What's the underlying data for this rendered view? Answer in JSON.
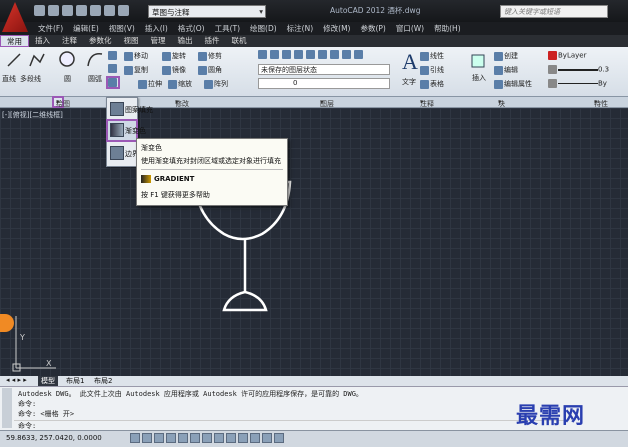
{
  "window": {
    "workspace": "草图与注释",
    "title": "AutoCAD 2012  酒杯.dwg",
    "search_placeholder": "键入关键字或短语"
  },
  "menubar": [
    "文件(F)",
    "编辑(E)",
    "视图(V)",
    "插入(I)",
    "格式(O)",
    "工具(T)",
    "绘图(D)",
    "标注(N)",
    "修改(M)",
    "参数(P)",
    "窗口(W)",
    "帮助(H)"
  ],
  "ribbon_tabs": [
    "常用",
    "插入",
    "注释",
    "参数化",
    "视图",
    "管理",
    "输出",
    "插件",
    "联机"
  ],
  "ribbon": {
    "draw_tools": [
      "直线",
      "多段线",
      "圆",
      "圆弧"
    ],
    "modify_tools": [
      "移动",
      "旋转",
      "修剪",
      "复制",
      "镜像",
      "圆角",
      "拉伸",
      "缩放",
      "阵列"
    ],
    "layer_state": "未保存的图层状态",
    "layer_value": "0",
    "annotation": {
      "text": "文字",
      "linear": "线性",
      "leader": "引线",
      "table": "表格"
    },
    "block": {
      "insert": "插入",
      "create": "创建",
      "edit": "编辑",
      "edit_attr": "编辑属性"
    },
    "properties": {
      "color": "ByLayer",
      "lineweight": "0.3",
      "linetype": "By"
    }
  },
  "panel_labels": {
    "draw": "绘图",
    "modify": "修改",
    "layers": "图层",
    "annotation": "注释",
    "block": "块",
    "properties": "特性"
  },
  "hatch_menu": {
    "items": [
      "图案填充",
      "渐变色",
      "边界"
    ]
  },
  "tooltip": {
    "title": "渐变色",
    "desc": "使用渐变填充对封闭区域或选定对象进行填充",
    "command": "GRADIENT",
    "help": "按 F1 键获得更多帮助"
  },
  "viewport_label": "[-][俯视][二维线框]",
  "ucs_label": {
    "x": "X",
    "y": "Y"
  },
  "layout_tabs": [
    "模型",
    "布局1",
    "布局2"
  ],
  "command_lines": [
    "Autodesk DWG。  此文件上次由 Autodesk 应用程序或 Autodesk 许可的应用程序保存，是可靠的 DWG。",
    "命令:",
    "命令: <栅格 开>",
    "命令:"
  ],
  "status_coords": "59.8633,  257.0420, 0.0000",
  "watermark": "最需网"
}
